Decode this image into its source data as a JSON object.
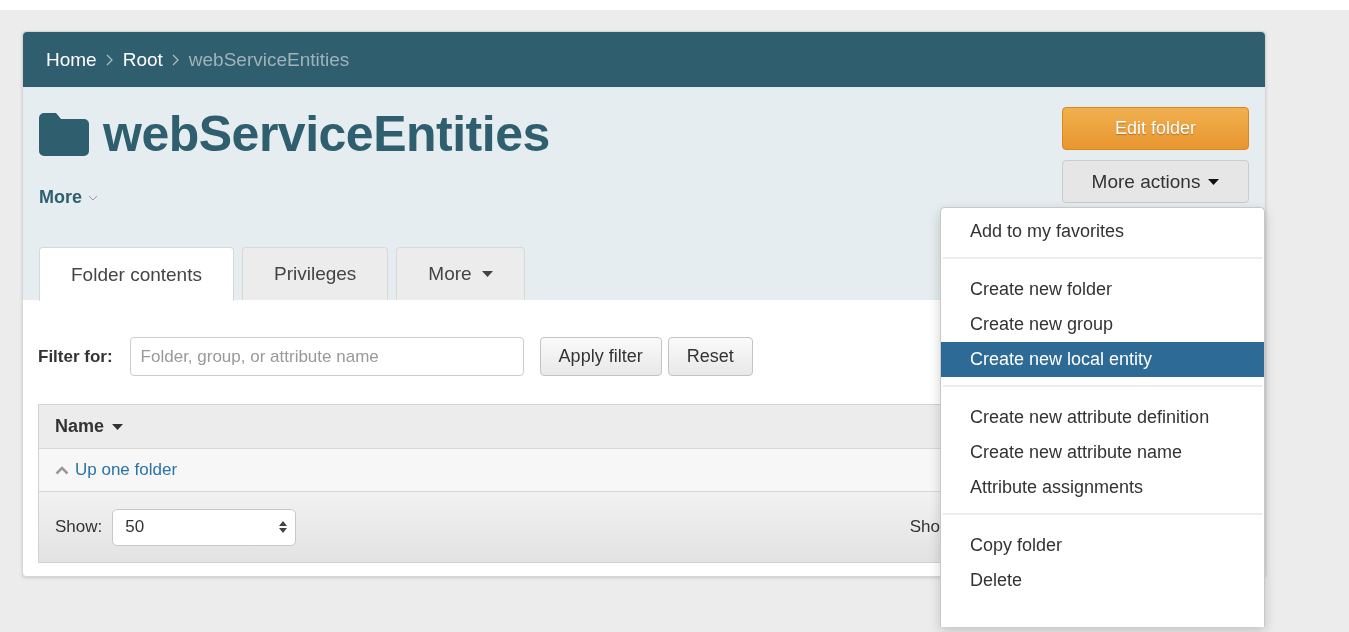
{
  "breadcrumb": [
    {
      "label": "Home",
      "current": false
    },
    {
      "label": "Root",
      "current": false
    },
    {
      "label": "webServiceEntities",
      "current": true
    }
  ],
  "title": "webServiceEntities",
  "more_link": "More",
  "actions": {
    "edit_button": "Edit folder",
    "more_button": "More actions"
  },
  "tabs": [
    {
      "label": "Folder contents",
      "selected": true,
      "kind": "plain"
    },
    {
      "label": "Privileges",
      "selected": false,
      "kind": "plain"
    },
    {
      "label": "More",
      "selected": false,
      "kind": "dropdown"
    }
  ],
  "filter": {
    "label": "Filter for:",
    "placeholder": "Folder, group, or attribute name",
    "apply_button": "Apply filter",
    "reset_button": "Reset"
  },
  "table": {
    "column": "Name",
    "rows": [
      {
        "label": "Up one folder"
      }
    ],
    "show_label": "Show:",
    "show_value": "50",
    "right_text": "Sho"
  },
  "menu": {
    "sections": [
      [
        {
          "label": "Add to my favorites",
          "selected": false
        }
      ],
      [
        {
          "label": "Create new folder",
          "selected": false
        },
        {
          "label": "Create new group",
          "selected": false
        },
        {
          "label": "Create new local entity",
          "selected": true
        }
      ],
      [
        {
          "label": "Create new attribute definition",
          "selected": false
        },
        {
          "label": "Create new attribute name",
          "selected": false
        },
        {
          "label": "Attribute assignments",
          "selected": false
        }
      ],
      [
        {
          "label": "Copy folder",
          "selected": false
        },
        {
          "label": "Delete",
          "selected": false
        }
      ]
    ]
  }
}
